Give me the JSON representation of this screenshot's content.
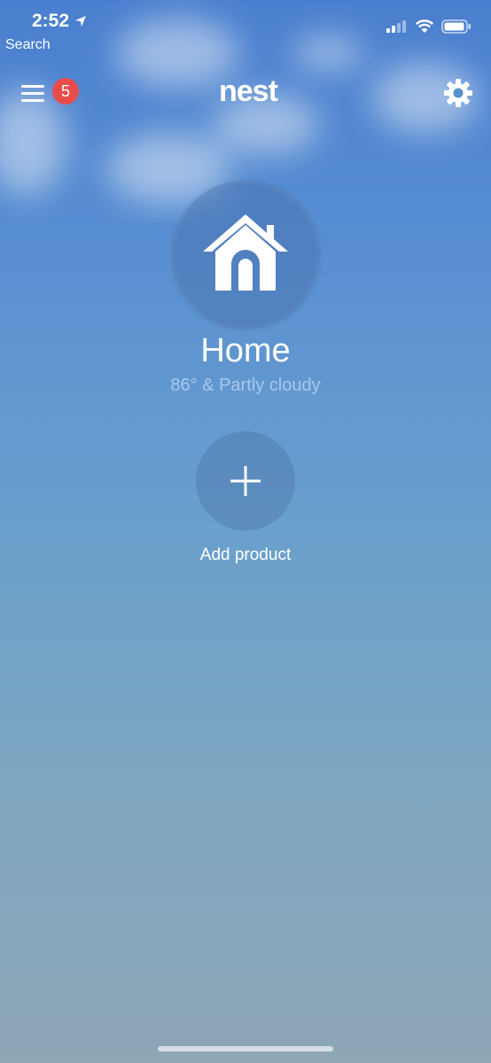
{
  "status_bar": {
    "time": "2:52",
    "back_label": "Search"
  },
  "nav": {
    "badge_count": "5",
    "logo_text": "nest"
  },
  "structure": {
    "name": "Home",
    "weather": "86° & Partly cloudy"
  },
  "actions": {
    "add_product_label": "Add product"
  },
  "icons": [
    "location-arrow-icon",
    "signal-icon",
    "wifi-icon",
    "battery-icon",
    "hamburger-menu-icon",
    "gear-icon",
    "house-icon",
    "plus-icon"
  ],
  "colors": {
    "badge": "#e74c4c",
    "weather_text": "#a9c7ea",
    "bg_top": "#4a7fcf",
    "bg_bottom": "#8ea6b6"
  }
}
